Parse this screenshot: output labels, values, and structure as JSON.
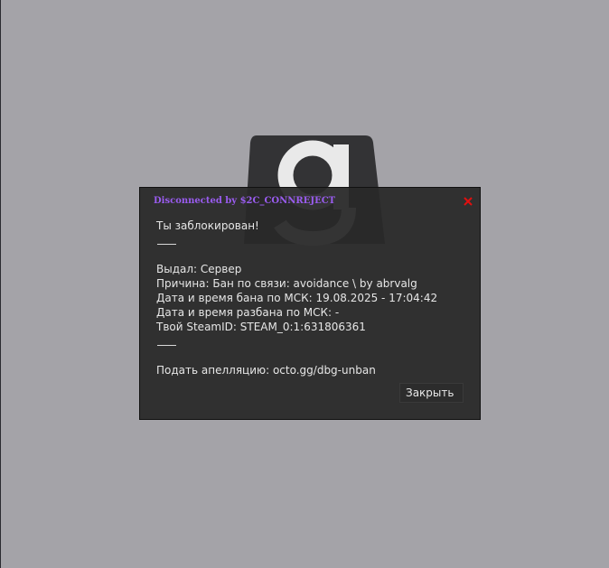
{
  "dialog": {
    "title": "Disconnected by $2C_CONNREJECT",
    "close_icon": "close-x-icon",
    "lines": {
      "blocked": "Ты заблокирован!",
      "issued_by": "Выдал: Сервер",
      "reason": "Причина: Бан по связи: avoidance \\ by abrvalg",
      "ban_date": "Дата и время бана по МСК: 19.08.2025 - 17:04:42",
      "unban_date": "Дата и время разбана по МСК: -",
      "steam_id": "Твой SteamID: STEAM_0:1:631806361",
      "appeal": "Подать апелляцию: octo.gg/dbg-unban"
    },
    "close_button_label": "Закрыть"
  },
  "background": {
    "logo_icon": "gmod-logo-icon"
  },
  "colors": {
    "title": "#9a5cf0",
    "close_x": "#e01010",
    "background": "#a4a3a8"
  }
}
